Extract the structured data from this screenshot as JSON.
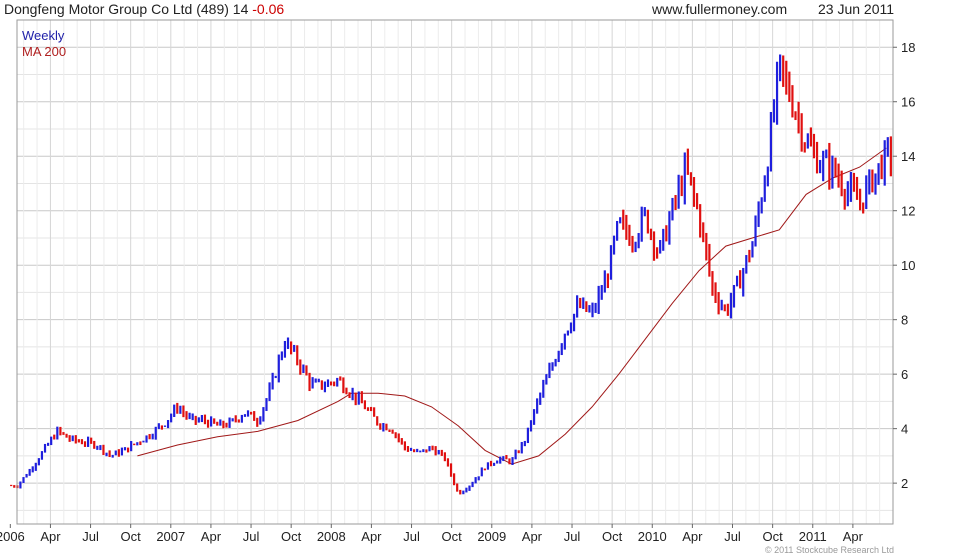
{
  "header": {
    "title": "Dongfeng Motor Group Co Ltd (489) 14",
    "change": "-0.06",
    "site": "www.fullermoney.com",
    "date": "23 Jun 2011"
  },
  "legend": {
    "series1": "Weekly",
    "series2": "MA 200"
  },
  "footer": {
    "copyright": "© 2011 Stockcube Research Ltd"
  },
  "colors": {
    "up": "#1f1fdd",
    "down": "#e01010",
    "ma": "#a01818",
    "grid": "#d8d8d8",
    "title_change": "#cc0000"
  },
  "chart_data": {
    "type": "line",
    "title": "Dongfeng Motor Group Co Ltd (489) 14",
    "ylim": [
      0.5,
      19
    ],
    "yticks": [
      2,
      4,
      6,
      8,
      10,
      12,
      14,
      16,
      18
    ],
    "grid": true,
    "legend_position": "top-left",
    "x_labels": [
      "2006",
      "Apr",
      "Jul",
      "Oct",
      "2007",
      "Apr",
      "Jul",
      "Oct",
      "2008",
      "Apr",
      "Jul",
      "Oct",
      "2009",
      "Apr",
      "Jul",
      "Oct",
      "2010",
      "Apr",
      "Jul",
      "Oct",
      "2011",
      "Apr"
    ],
    "series": [
      {
        "name": "Weekly",
        "style": "price bars",
        "x": [
          "2006-01",
          "2006-02",
          "2006-03",
          "2006-04",
          "2006-05",
          "2006-06",
          "2006-07",
          "2006-08",
          "2006-09",
          "2006-10",
          "2006-11",
          "2006-12",
          "2007-01",
          "2007-02",
          "2007-03",
          "2007-04",
          "2007-05",
          "2007-06",
          "2007-07",
          "2007-08",
          "2007-09",
          "2007-10",
          "2007-11",
          "2007-12",
          "2008-01",
          "2008-02",
          "2008-03",
          "2008-04",
          "2008-05",
          "2008-06",
          "2008-07",
          "2008-08",
          "2008-09",
          "2008-10",
          "2008-11",
          "2008-12",
          "2009-01",
          "2009-02",
          "2009-03",
          "2009-04",
          "2009-05",
          "2009-06",
          "2009-07",
          "2009-08",
          "2009-09",
          "2009-10",
          "2009-11",
          "2009-12",
          "2010-01",
          "2010-02",
          "2010-03",
          "2010-04",
          "2010-05",
          "2010-06",
          "2010-07",
          "2010-08",
          "2010-09",
          "2010-10",
          "2010-11",
          "2010-12",
          "2011-01",
          "2011-02",
          "2011-03",
          "2011-04",
          "2011-05",
          "2011-06"
        ],
        "values": [
          1.9,
          2.5,
          3.2,
          3.9,
          3.6,
          3.5,
          3.4,
          3.0,
          3.2,
          3.5,
          3.8,
          4.2,
          4.8,
          4.3,
          4.3,
          4.1,
          4.2,
          4.6,
          4.3,
          5.5,
          7.2,
          6.5,
          5.6,
          5.6,
          5.8,
          5.3,
          4.8,
          4.2,
          4.0,
          3.3,
          3.1,
          3.3,
          2.9,
          1.6,
          2.0,
          2.6,
          2.9,
          2.8,
          3.6,
          5.1,
          6.3,
          7.6,
          8.5,
          8.2,
          9.4,
          11.5,
          11.0,
          11.8,
          10.4,
          12.0,
          13.5,
          11.8,
          9.1,
          8.3,
          9.4,
          10.8,
          13.5,
          17.2,
          16.0,
          14.5,
          13.8,
          13.5,
          12.8,
          12.3,
          13.2,
          14.0
        ]
      },
      {
        "name": "MA 200",
        "style": "line",
        "x": [
          "2006-10",
          "2007-01",
          "2007-04",
          "2007-07",
          "2007-10",
          "2008-01",
          "2008-02",
          "2008-04",
          "2008-06",
          "2008-08",
          "2008-10",
          "2008-12",
          "2009-02",
          "2009-04",
          "2009-06",
          "2009-08",
          "2009-10",
          "2009-12",
          "2010-02",
          "2010-04",
          "2010-06",
          "2010-08",
          "2010-10",
          "2010-12",
          "2011-02",
          "2011-04",
          "2011-06"
        ],
        "values": [
          3.0,
          3.4,
          3.7,
          3.9,
          4.3,
          5.0,
          5.3,
          5.3,
          5.2,
          4.8,
          4.1,
          3.2,
          2.7,
          3.0,
          3.8,
          4.8,
          6.0,
          7.3,
          8.6,
          9.8,
          10.7,
          11.0,
          11.3,
          12.6,
          13.2,
          13.6,
          14.3
        ]
      }
    ]
  }
}
